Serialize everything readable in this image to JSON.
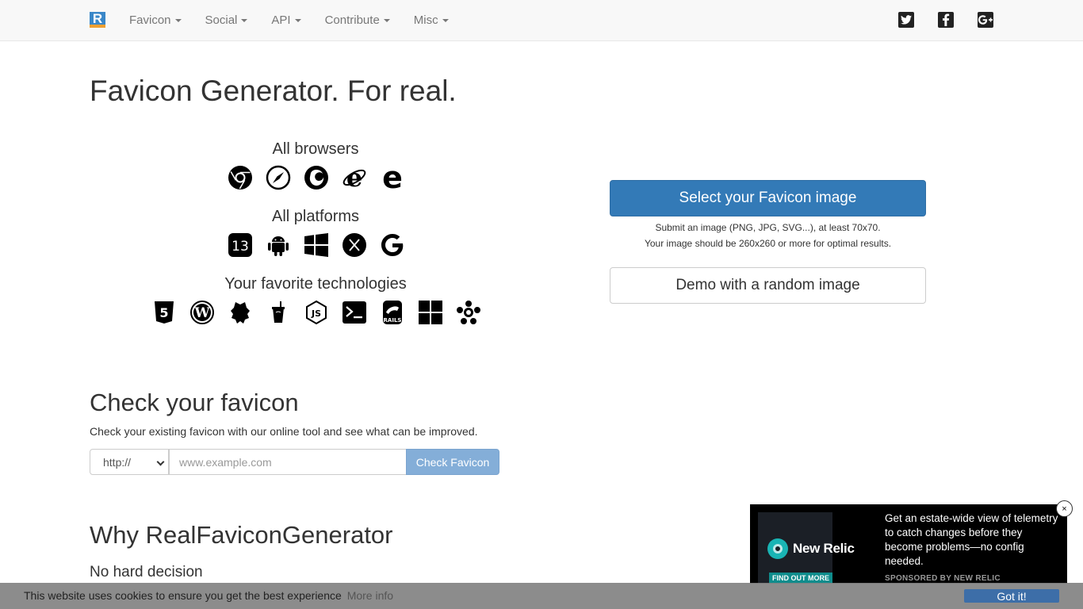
{
  "nav": {
    "logo_letter": "R",
    "menu": [
      {
        "label": "Favicon"
      },
      {
        "label": "Social"
      },
      {
        "label": "API"
      },
      {
        "label": "Contribute"
      },
      {
        "label": "Misc"
      }
    ],
    "social_icons": [
      "twitter-icon",
      "facebook-icon",
      "google-plus-icon"
    ]
  },
  "hero": {
    "title": "Favicon Generator. For real.",
    "browsers_title": "All browsers",
    "browsers_icons": [
      "chrome-icon",
      "safari-icon",
      "firefox-icon",
      "internet-explorer-icon",
      "edge-icon"
    ],
    "platforms_title": "All platforms",
    "platforms_icons": [
      "ios-icon",
      "android-icon",
      "windows-icon",
      "macos-icon",
      "google-icon"
    ],
    "tech_title": "Your favorite technologies",
    "tech_icons": [
      "html5-icon",
      "wordpress-icon",
      "gulp-icon",
      "grunt-icon",
      "nodejs-icon",
      "cli-icon",
      "rails-icon",
      "aspnet-icon",
      "joomla-icon"
    ],
    "select_button": "Select your Favicon image",
    "help_line1": "Submit an image (PNG, JPG, SVG...), at least 70x70.",
    "help_line2": "Your image should be 260x260 or more for optimal results.",
    "demo_button": "Demo with a random image"
  },
  "check": {
    "title": "Check your favicon",
    "description": "Check your existing favicon with our online tool and see what can be improved.",
    "protocol_value": "http://",
    "url_placeholder": "www.example.com",
    "button": "Check Favicon"
  },
  "why": {
    "title": "Why RealFaviconGenerator",
    "subtitle": "No hard decision"
  },
  "ad": {
    "brand": "New Relic",
    "cta": "FIND OUT MORE",
    "text": "Get an estate-wide view of telemetry to catch changes before they become problems—no config needed.",
    "sponsor": "SPONSORED BY NEW RELIC",
    "close": "×"
  },
  "cookie": {
    "text": "This website uses cookies to ensure you get the best experience",
    "link": "More info",
    "button": "Got it!"
  },
  "colors": {
    "primary": "#337ab7",
    "check_button": "#84aed8",
    "ad_accent": "#19b4b4"
  }
}
